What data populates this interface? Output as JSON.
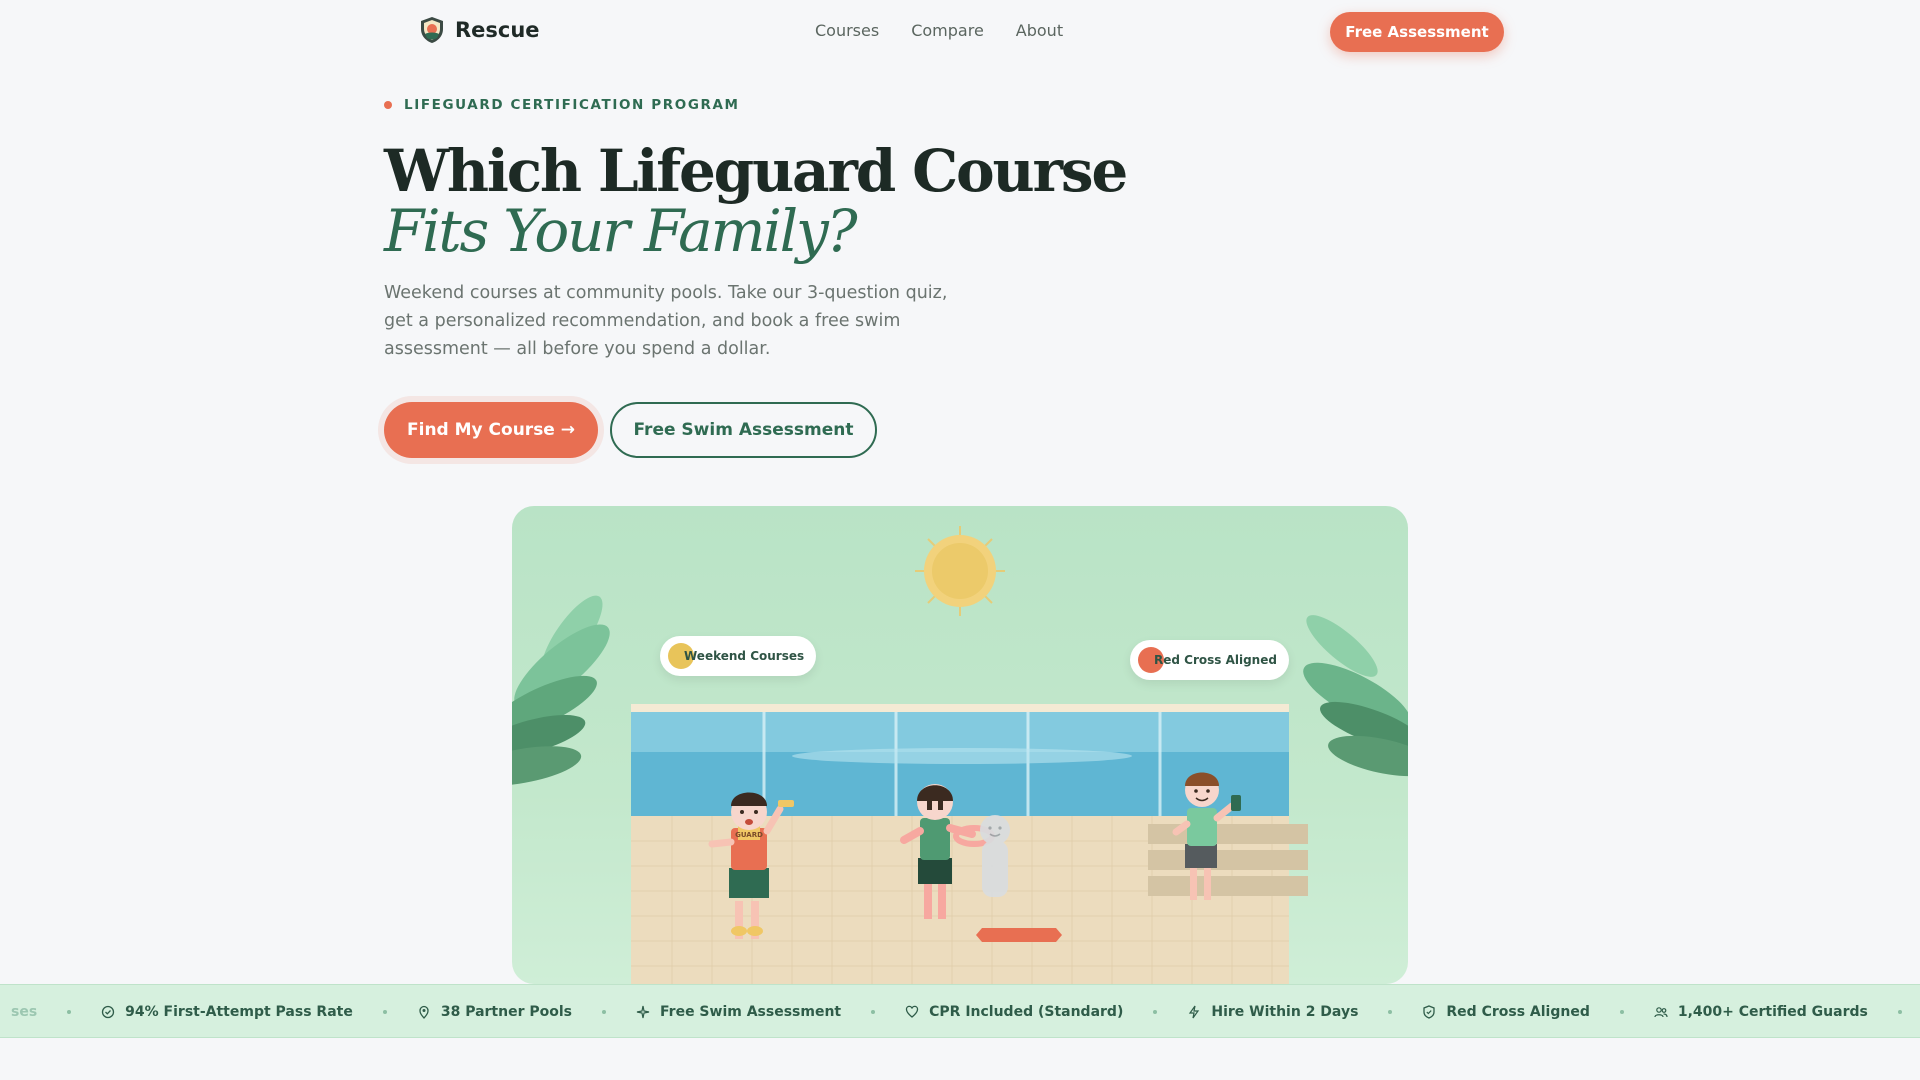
{
  "nav": {
    "brand": "Rescue",
    "links": [
      "Courses",
      "Compare",
      "About"
    ],
    "cta": "Free Assessment"
  },
  "hero": {
    "eyebrow": "LIFEGUARD CERTIFICATION PROGRAM",
    "title_line1": "Which Lifeguard Course",
    "title_line2": "Fits Your Family?",
    "subtitle": "Weekend courses at community pools. Take our 3-question quiz, get a personalized recommendation, and book a free swim assessment — all before you spend a dollar.",
    "primary_button": "Find My Course →",
    "secondary_button": "Free Swim Assessment"
  },
  "illustration": {
    "badge_left": "Weekend Courses",
    "badge_right": "Red Cross Aligned",
    "shirt_text": "GUARD"
  },
  "ticker": {
    "partial_item": "ses",
    "items": [
      {
        "icon": "check-circle-icon",
        "label": "94% First-Attempt Pass Rate"
      },
      {
        "icon": "map-pin-icon",
        "label": "38 Partner Pools"
      },
      {
        "icon": "sparkle-icon",
        "label": "Free Swim Assessment"
      },
      {
        "icon": "heart-icon",
        "label": "CPR Included (Standard)"
      },
      {
        "icon": "lightning-icon",
        "label": "Hire Within 2 Days"
      },
      {
        "icon": "shield-icon",
        "label": "Red Cross Aligned"
      },
      {
        "icon": "users-icon",
        "label": "1,400+ Certified Guards"
      }
    ]
  },
  "colors": {
    "accent": "#e86f52",
    "brand_green": "#2f6b52",
    "ticker_bg": "#d6f0de",
    "scene_bg": "#b9e3c6"
  }
}
